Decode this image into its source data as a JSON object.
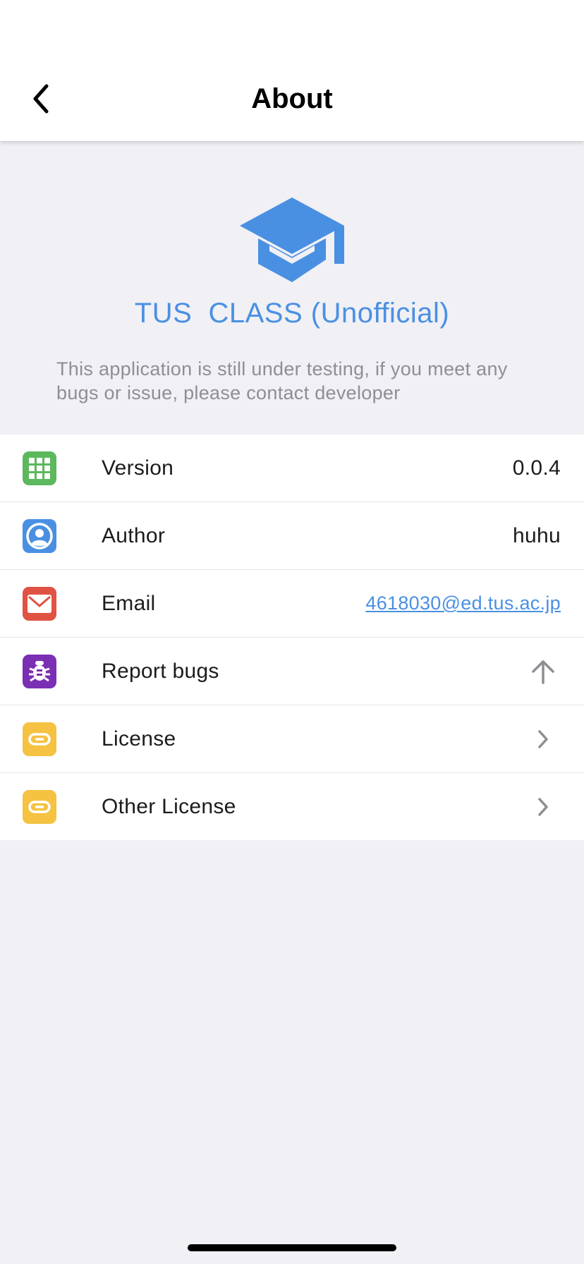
{
  "nav": {
    "title": "About",
    "back_icon": "chevron-left-icon"
  },
  "header": {
    "logo_icon": "graduation-cap-icon",
    "app_name": "TUS  CLASS (Unofficial)",
    "description": "This application is still under testing, if you meet any bugs or issue, please contact developer"
  },
  "rows": [
    {
      "icon": "grid-icon",
      "color": "#5cb85c",
      "label": "Version",
      "value": "0.0.4"
    },
    {
      "icon": "user-icon",
      "color": "#4a90e2",
      "label": "Author",
      "value": "huhu"
    },
    {
      "icon": "mail-icon",
      "color": "#e05243",
      "label": "Email",
      "value": "4618030@ed.tus.ac.jp"
    },
    {
      "icon": "bug-icon",
      "color": "#7b2fb4",
      "label": "Report bugs",
      "accessory": "arrow-up-icon"
    },
    {
      "icon": "link-icon",
      "color": "#f5c242",
      "label": "License",
      "accessory": "chevron-right-icon"
    },
    {
      "icon": "link-icon",
      "color": "#f5c242",
      "label": "Other License",
      "accessory": "chevron-right-icon"
    }
  ],
  "colors": {
    "accent": "#4a90e2",
    "background": "#f0f0f5"
  }
}
